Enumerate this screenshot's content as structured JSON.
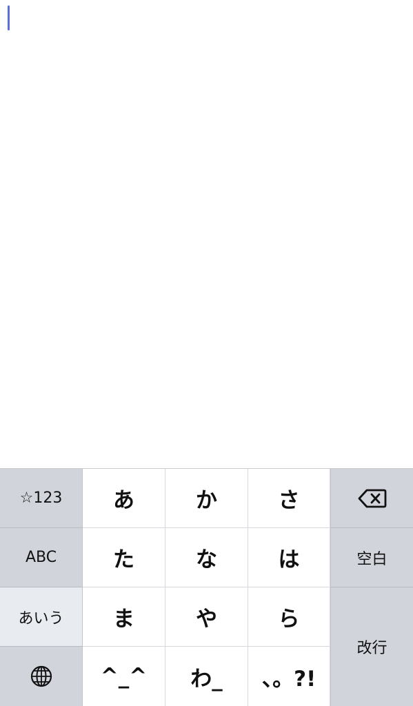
{
  "editor": {
    "text": ""
  },
  "keyboard": {
    "left_keys": {
      "symbols": "☆123",
      "english": "ABC",
      "hiragana": "あいう",
      "globe_icon": "globe-icon"
    },
    "main_keys": [
      [
        "あ",
        "か",
        "さ"
      ],
      [
        "た",
        "な",
        "は"
      ],
      [
        "ま",
        "や",
        "ら"
      ],
      [
        "^_^",
        "わ_",
        "、。?!"
      ]
    ],
    "right_keys": {
      "delete_icon": "backspace-icon",
      "space": "空白",
      "enter": "改行"
    },
    "colors": {
      "key_white": "#ffffff",
      "side_gray": "#d1d4db",
      "active_side": "#e8ebef",
      "caret": "#5b6fd6"
    }
  }
}
